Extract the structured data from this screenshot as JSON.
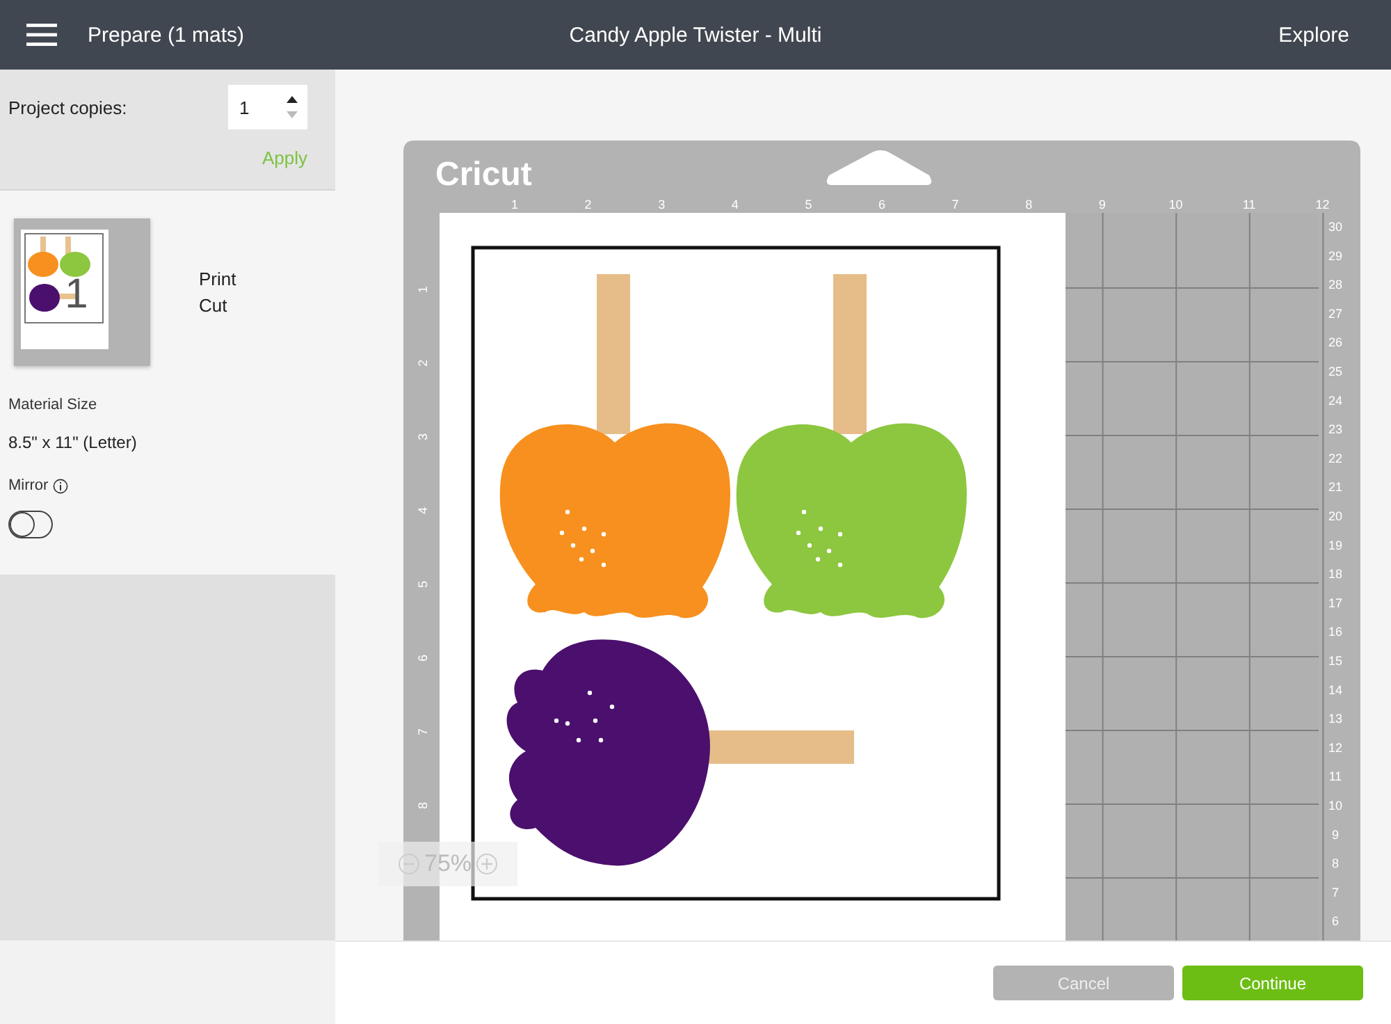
{
  "top_bar": {
    "title": "Prepare (1 mats)",
    "project_name": "Candy Apple Twister - Multi",
    "explore": "Explore"
  },
  "sidebar": {
    "copies_label": "Project copies:",
    "copies_value": "1",
    "apply": "Apply",
    "mats": [
      {
        "number": "1",
        "operations": [
          "Print",
          "Cut"
        ]
      }
    ],
    "material_label": "Material Size",
    "material_value": "8.5\" x 11\" (Letter)",
    "mirror_label": "Mirror",
    "mirror": {
      "on": false
    }
  },
  "mat": {
    "brand": "Cricut",
    "top_ruler": [
      "1",
      "2",
      "3",
      "4",
      "5",
      "6",
      "7",
      "8",
      "9",
      "10",
      "11",
      "12"
    ],
    "left_ruler": [
      "1",
      "2",
      "3",
      "4",
      "5",
      "6",
      "7",
      "8"
    ],
    "right_ruler": [
      "30",
      "29",
      "28",
      "27",
      "26",
      "25",
      "24",
      "23",
      "22",
      "21",
      "20",
      "19",
      "18",
      "17",
      "16",
      "15",
      "14",
      "13",
      "12",
      "11",
      "10",
      "9",
      "8",
      "7",
      "6"
    ]
  },
  "zoom": {
    "value": "75%"
  },
  "buttons": [
    {
      "label": "Cancel",
      "disabled": true
    },
    {
      "label": "Continue",
      "disabled": false
    }
  ]
}
